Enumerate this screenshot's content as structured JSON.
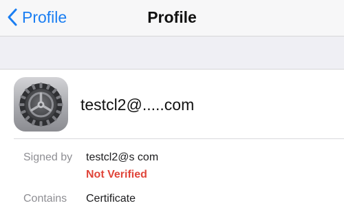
{
  "nav": {
    "back_label": "Profile",
    "title": "Profile",
    "accent_color": "#1a7ef2"
  },
  "profile": {
    "icon": "settings-gear-icon",
    "name": "testcl2@.....com"
  },
  "details": {
    "signed_by_label": "Signed by",
    "signed_by_value": "testcl2@s       com",
    "status": "Not Verified",
    "status_color": "#e0453a",
    "contains_label": "Contains",
    "contains_value": "Certificate"
  }
}
